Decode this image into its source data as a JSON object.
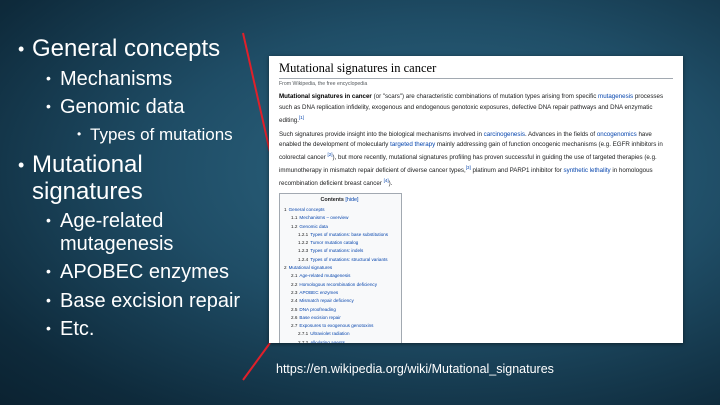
{
  "outline": [
    {
      "level": 1,
      "text": "General concepts"
    },
    {
      "level": 2,
      "text": "Mechanisms"
    },
    {
      "level": 2,
      "text": "Genomic data"
    },
    {
      "level": 3,
      "text": "Types of mutations"
    },
    {
      "level": 1,
      "text": "Mutational signatures"
    },
    {
      "level": 2,
      "text": "Age-related mutagenesis"
    },
    {
      "level": 2,
      "text": "APOBEC enzymes"
    },
    {
      "level": 2,
      "text": "Base excision repair"
    },
    {
      "level": 2,
      "text": "Etc."
    }
  ],
  "wiki": {
    "title": "Mutational signatures in cancer",
    "from": "From Wikipedia, the free encyclopedia",
    "p1": [
      {
        "t": "Mutational signatures in cancer",
        "s": "b"
      },
      {
        "t": " (or \"scars\") are characteristic combinations of mutation types arising from specific "
      },
      {
        "t": "mutagenesis",
        "s": "a"
      },
      {
        "t": " processes such as DNA replication infidelity, exogenous and endogenous genotoxic exposures, defective DNA repair pathways and DNA enzymatic editing."
      },
      {
        "t": "[1]",
        "s": "sup"
      }
    ],
    "p2": [
      {
        "t": "Such signatures provide insight into the biological mechanisms involved in "
      },
      {
        "t": "carcinogenesis",
        "s": "a"
      },
      {
        "t": ". Advances in the fields of "
      },
      {
        "t": "oncogenomics",
        "s": "a"
      },
      {
        "t": " have enabled the development of molecularly "
      },
      {
        "t": "targeted therapy",
        "s": "a"
      },
      {
        "t": " mainly addressing gain of function oncogenic mechanisms (e.g. EGFR inhibitors in colorectal cancer "
      },
      {
        "t": "[2]",
        "s": "sup"
      },
      {
        "t": "), but more recently, mutational signatures profiling has proven successful in guiding the use of targeted therapies (e.g. immunotherapy in mismatch repair deficient of diverse cancer types,"
      },
      {
        "t": "[3]",
        "s": "sup"
      },
      {
        "t": " platinum and PARP1 inhibitor for "
      },
      {
        "t": "synthetic lethality",
        "s": "a"
      },
      {
        "t": " in homologous recombination deficient breast cancer "
      },
      {
        "t": "[4]",
        "s": "sup"
      },
      {
        "t": ")."
      }
    ],
    "toc_title": "Contents",
    "toc_hide": "[hide]",
    "toc": [
      {
        "n": "1",
        "t": "General concepts",
        "d": 1
      },
      {
        "n": "1.1",
        "t": "Mechanisms – overview",
        "d": 2
      },
      {
        "n": "1.2",
        "t": "Genomic data",
        "d": 2
      },
      {
        "n": "1.2.1",
        "t": "Types of mutations: base substitutions",
        "d": 3
      },
      {
        "n": "1.2.2",
        "t": "Tumor mutation catalog",
        "d": 3
      },
      {
        "n": "1.2.3",
        "t": "Types of mutations: indels",
        "d": 3
      },
      {
        "n": "1.2.4",
        "t": "Types of mutations: structural variants",
        "d": 3
      },
      {
        "n": "2",
        "t": "Mutational signatures",
        "d": 1
      },
      {
        "n": "2.1",
        "t": "Age-related mutagenesis",
        "d": 2
      },
      {
        "n": "2.2",
        "t": "Homologous recombination deficiency",
        "d": 2
      },
      {
        "n": "2.3",
        "t": "APOBEC enzymes",
        "d": 2
      },
      {
        "n": "2.4",
        "t": "Mismatch repair deficiency",
        "d": 2
      },
      {
        "n": "2.5",
        "t": "DNA proofreading",
        "d": 2
      },
      {
        "n": "2.6",
        "t": "Base excision repair",
        "d": 2
      },
      {
        "n": "2.7",
        "t": "Exposures to exogenous genotoxins",
        "d": 2
      },
      {
        "n": "2.7.1",
        "t": "Ultraviolet radiation",
        "d": 3
      },
      {
        "n": "2.7.2",
        "t": "Alkylating agents",
        "d": 3
      },
      {
        "n": "2.7.3",
        "t": "Tobacco",
        "d": 3
      },
      {
        "n": "2.8",
        "t": "Immunoglobulin gene hypermutation",
        "d": 2
      },
      {
        "n": "3",
        "t": "Note list",
        "d": 1
      },
      {
        "n": "4",
        "t": "References",
        "d": 1
      }
    ]
  },
  "url": "https://en.wikipedia.org/wiki/Mutational_signatures",
  "colors": {
    "line": "#e0202a",
    "link": "#0645ad"
  }
}
